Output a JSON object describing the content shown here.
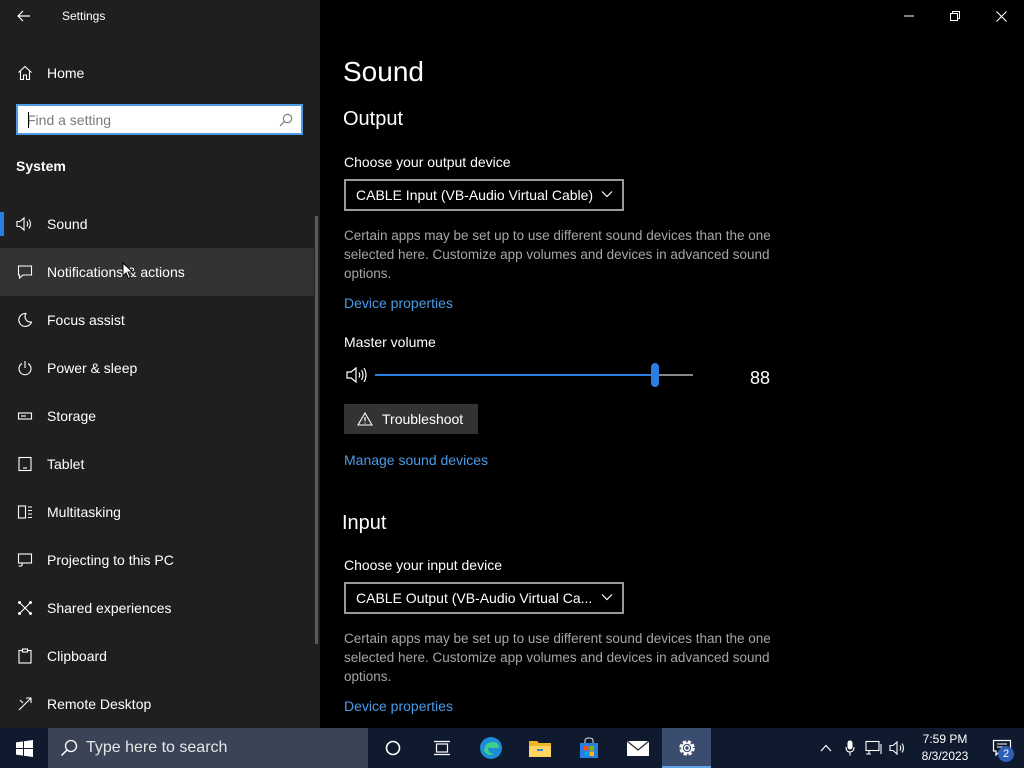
{
  "window": {
    "title": "Settings"
  },
  "sidebar": {
    "home_label": "Home",
    "search_placeholder": "Find a setting",
    "section_title": "System",
    "items": [
      {
        "label": "Sound",
        "icon": "speaker-icon",
        "selected": true
      },
      {
        "label": "Notifications & actions",
        "icon": "message-icon",
        "hover": true
      },
      {
        "label": "Focus assist",
        "icon": "moon-icon"
      },
      {
        "label": "Power & sleep",
        "icon": "power-icon"
      },
      {
        "label": "Storage",
        "icon": "storage-icon"
      },
      {
        "label": "Tablet",
        "icon": "tablet-icon"
      },
      {
        "label": "Multitasking",
        "icon": "multitasking-icon"
      },
      {
        "label": "Projecting to this PC",
        "icon": "projecting-icon"
      },
      {
        "label": "Shared experiences",
        "icon": "shared-icon"
      },
      {
        "label": "Clipboard",
        "icon": "clipboard-icon"
      },
      {
        "label": "Remote Desktop",
        "icon": "remote-desktop-icon"
      }
    ]
  },
  "main": {
    "title": "Sound",
    "output": {
      "heading": "Output",
      "device_label": "Choose your output device",
      "device_value": "CABLE Input (VB-Audio Virtual Cable)",
      "description": "Certain apps may be set up to use different sound devices than the one selected here. Customize app volumes and devices in advanced sound options.",
      "device_properties": "Device properties",
      "master_volume_label": "Master volume",
      "master_volume_value": "88",
      "troubleshoot": "Troubleshoot",
      "manage_devices": "Manage sound devices"
    },
    "input": {
      "heading": "Input",
      "device_label": "Choose your input device",
      "device_value": "CABLE Output (VB-Audio Virtual Ca...",
      "description": "Certain apps may be set up to use different sound devices than the one selected here. Customize app volumes and devices in advanced sound options.",
      "device_properties": "Device properties"
    }
  },
  "taskbar": {
    "search_placeholder": "Type here to search",
    "time": "7:59 PM",
    "date": "8/3/2023",
    "notification_count": "2"
  },
  "colors": {
    "accent": "#2a7de1",
    "link": "#4b9be8",
    "taskbar": "#101a2e"
  }
}
